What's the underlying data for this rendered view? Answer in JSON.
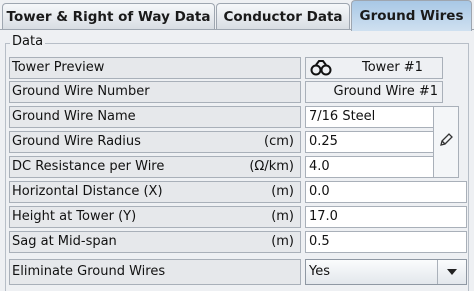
{
  "tabs": [
    {
      "label": "Tower & Right of Way Data"
    },
    {
      "label": "Conductor Data"
    },
    {
      "label": "Ground Wires"
    }
  ],
  "group": {
    "title": "Data"
  },
  "rows": {
    "tower_preview": {
      "label": "Tower Preview",
      "value": "Tower #1",
      "icon": "binoculars-icon"
    },
    "ground_wire_number": {
      "label": "Ground Wire Number",
      "value": "Ground Wire #1"
    },
    "ground_wire_name": {
      "label": "Ground Wire Name",
      "value": "7/16 Steel"
    },
    "ground_wire_radius": {
      "label": "Ground Wire Radius",
      "unit": "(cm)",
      "value": "0.25"
    },
    "dc_resistance": {
      "label": "DC Resistance per Wire",
      "unit": "(Ω/km)",
      "value": "4.0"
    },
    "horizontal_distance": {
      "label": "Horizontal Distance (X)",
      "unit": "(m)",
      "value": "0.0"
    },
    "height_at_tower": {
      "label": "Height at Tower (Y)",
      "unit": "(m)",
      "value": "17.0"
    },
    "sag_mid_span": {
      "label": "Sag at Mid-span",
      "unit": "(m)",
      "value": "0.5"
    },
    "eliminate_ground_wires": {
      "label": "Eliminate Ground Wires",
      "value": "Yes"
    }
  },
  "side_button": {
    "icon": "pencil-icon"
  },
  "colors": {
    "active_tab": "#b9d4ec",
    "background": "#eef0f3",
    "border": "#a9b0b9"
  }
}
